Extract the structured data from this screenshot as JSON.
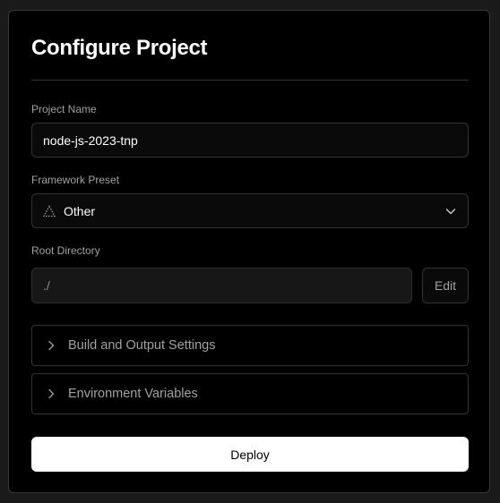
{
  "page": {
    "title": "Configure Project"
  },
  "project_name": {
    "label": "Project Name",
    "value": "node-js-2023-tnp"
  },
  "framework_preset": {
    "label": "Framework Preset",
    "selected": "Other",
    "icon": "framework-triangle-icon"
  },
  "root_directory": {
    "label": "Root Directory",
    "value": "./",
    "edit_label": "Edit"
  },
  "sections": [
    {
      "label": "Build and Output Settings",
      "icon": "chevron-right-icon"
    },
    {
      "label": "Environment Variables",
      "icon": "chevron-right-icon"
    }
  ],
  "deploy": {
    "label": "Deploy"
  },
  "colors": {
    "background": "#000000",
    "border": "#333333",
    "primary_button": "#ffffff",
    "text": "#ededed",
    "muted_text": "#a1a1a1"
  }
}
